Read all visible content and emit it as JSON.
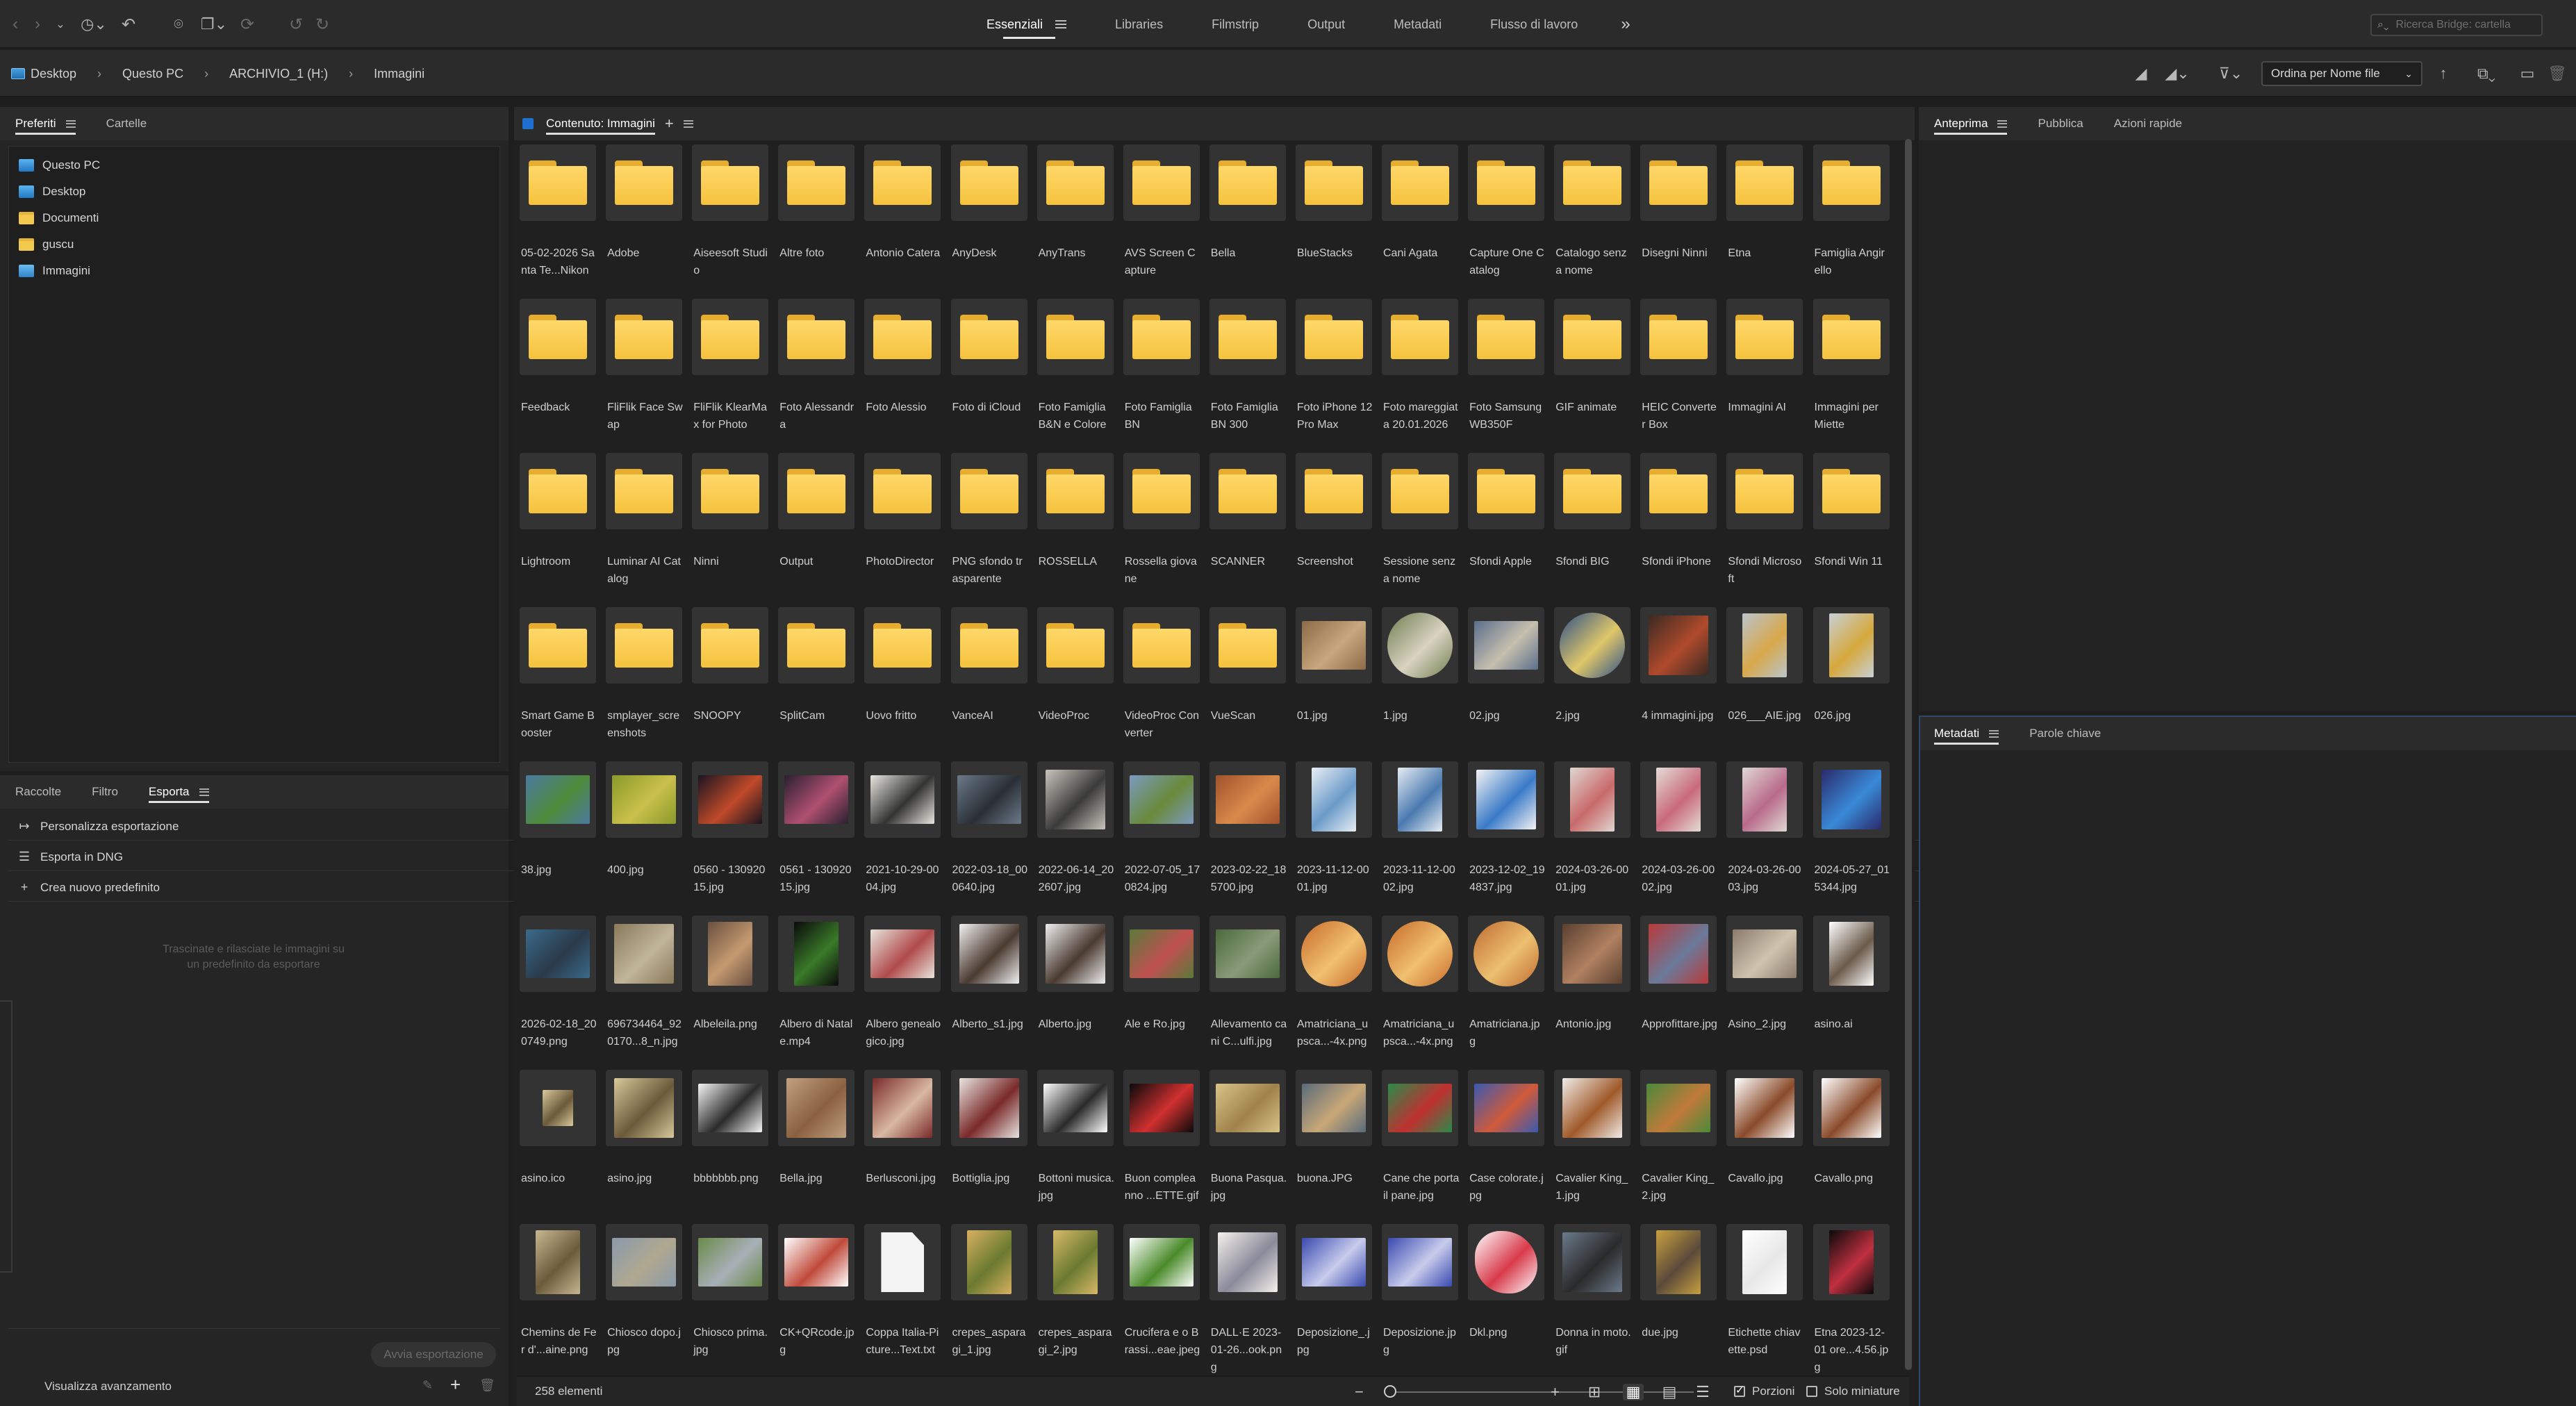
{
  "toolbar": {
    "icons": [
      "back-arrow-icon",
      "forward-arrow-icon",
      "chevron-down-icon",
      "recent-icon",
      "boomerang-icon",
      "camera-icon",
      "copy-icon",
      "refresh-icon",
      "undo-icon",
      "redo-icon"
    ],
    "workspaces": [
      {
        "label": "Essenziali",
        "active": true
      },
      {
        "label": "Libraries",
        "active": false
      },
      {
        "label": "Filmstrip",
        "active": false
      },
      {
        "label": "Output",
        "active": false
      },
      {
        "label": "Metadati",
        "active": false
      },
      {
        "label": "Flusso di lavoro",
        "active": false
      }
    ],
    "overflow_label": "»",
    "search_placeholder": "Ricerca Bridge: cartella"
  },
  "pathbar": {
    "crumbs": [
      "Desktop",
      "Questo PC",
      "ARCHIVIO_1 (H:)",
      "Immagini"
    ],
    "separator": "›",
    "sort_label": "Ordina per Nome file"
  },
  "left_top": {
    "tabs": [
      {
        "label": "Preferiti",
        "active": true
      },
      {
        "label": "Cartelle",
        "active": false
      }
    ],
    "favorites": [
      {
        "label": "Questo PC",
        "icon": "pc"
      },
      {
        "label": "Desktop",
        "icon": "pc"
      },
      {
        "label": "Documenti",
        "icon": "folder"
      },
      {
        "label": "guscu",
        "icon": "folder"
      },
      {
        "label": "Immagini",
        "icon": "img"
      }
    ]
  },
  "left_bottom": {
    "tabs": [
      {
        "label": "Raccolte",
        "active": false
      },
      {
        "label": "Filtro",
        "active": false
      },
      {
        "label": "Esporta",
        "active": true
      }
    ],
    "rows": [
      {
        "label": "Personalizza esportazione",
        "icon": "↦"
      },
      {
        "label": "Esporta in DNG",
        "icon": "☰"
      },
      {
        "label": "Crea nuovo predefinito",
        "icon": "+"
      }
    ],
    "drop_hint": "Trascinate e rilasciate le immagini su un predefinito da esportare",
    "export_button": "Avvia esportazione",
    "progress_label": "Visualizza avanzamento"
  },
  "content": {
    "title": "Contenuto: Immagini",
    "count": "258 elementi",
    "items": [
      {
        "name": "05-02-2026 Santa Te...Nikon",
        "kind": "folder"
      },
      {
        "name": "Adobe",
        "kind": "folder"
      },
      {
        "name": "Aiseesoft Studio",
        "kind": "folder"
      },
      {
        "name": "Altre foto",
        "kind": "folder"
      },
      {
        "name": "Antonio Catera",
        "kind": "folder"
      },
      {
        "name": "AnyDesk",
        "kind": "folder"
      },
      {
        "name": "AnyTrans",
        "kind": "folder"
      },
      {
        "name": "AVS Screen Capture",
        "kind": "folder"
      },
      {
        "name": "Bella",
        "kind": "folder"
      },
      {
        "name": "BlueStacks",
        "kind": "folder"
      },
      {
        "name": "Cani Agata",
        "kind": "folder"
      },
      {
        "name": "Capture One Catalog",
        "kind": "folder"
      },
      {
        "name": "Catalogo senza nome",
        "kind": "folder"
      },
      {
        "name": "Disegni Ninni",
        "kind": "folder"
      },
      {
        "name": "Etna",
        "kind": "folder"
      },
      {
        "name": "Famiglia Angirello",
        "kind": "folder"
      },
      {
        "name": "Feedback",
        "kind": "folder"
      },
      {
        "name": "FliFlik Face Swap",
        "kind": "folder"
      },
      {
        "name": "FliFlik KlearMax for Photo",
        "kind": "folder"
      },
      {
        "name": "Foto Alessandra",
        "kind": "folder"
      },
      {
        "name": "Foto Alessio",
        "kind": "folder"
      },
      {
        "name": "Foto di iCloud",
        "kind": "folder"
      },
      {
        "name": "Foto Famiglia B&N e Colore",
        "kind": "folder"
      },
      {
        "name": "Foto Famiglia BN",
        "kind": "folder"
      },
      {
        "name": "Foto Famiglia BN 300",
        "kind": "folder"
      },
      {
        "name": "Foto iPhone 12 Pro Max",
        "kind": "folder"
      },
      {
        "name": "Foto mareggiata 20.01.2026",
        "kind": "folder"
      },
      {
        "name": "Foto Samsung WB350F",
        "kind": "folder"
      },
      {
        "name": "GIF animate",
        "kind": "folder"
      },
      {
        "name": "HEIC Converter Box",
        "kind": "folder"
      },
      {
        "name": "Immagini AI",
        "kind": "folder"
      },
      {
        "name": "Immagini per Miette",
        "kind": "folder"
      },
      {
        "name": "Lightroom",
        "kind": "folder"
      },
      {
        "name": "Luminar AI Catalog",
        "kind": "folder"
      },
      {
        "name": "Ninni",
        "kind": "folder"
      },
      {
        "name": "Output",
        "kind": "folder"
      },
      {
        "name": "PhotoDirector",
        "kind": "folder"
      },
      {
        "name": "PNG sfondo trasparente",
        "kind": "folder"
      },
      {
        "name": "ROSSELLA",
        "kind": "folder"
      },
      {
        "name": "Rossella giovane",
        "kind": "folder"
      },
      {
        "name": "SCANNER",
        "kind": "folder"
      },
      {
        "name": "Screenshot",
        "kind": "folder"
      },
      {
        "name": "Sessione senza nome",
        "kind": "folder"
      },
      {
        "name": "Sfondi Apple",
        "kind": "folder"
      },
      {
        "name": "Sfondi BIG",
        "kind": "folder"
      },
      {
        "name": "Sfondi iPhone",
        "kind": "folder"
      },
      {
        "name": "Sfondi Microsoft",
        "kind": "folder"
      },
      {
        "name": "Sfondi Win 11",
        "kind": "folder"
      },
      {
        "name": "Smart Game Booster",
        "kind": "folder"
      },
      {
        "name": "smplayer_screenshots",
        "kind": "folder"
      },
      {
        "name": "SNOOPY",
        "kind": "folder"
      },
      {
        "name": "SplitCam",
        "kind": "folder"
      },
      {
        "name": "Uovo fritto",
        "kind": "folder"
      },
      {
        "name": "VanceAI",
        "kind": "folder"
      },
      {
        "name": "VideoProc",
        "kind": "folder"
      },
      {
        "name": "VideoProc Converter",
        "kind": "folder"
      },
      {
        "name": "VueScan",
        "kind": "folder"
      },
      {
        "name": "01.jpg",
        "kind": "image",
        "colors": [
          "#8a6b4a",
          "#c9a77d"
        ],
        "shape": "wide"
      },
      {
        "name": "1.jpg",
        "kind": "image",
        "colors": [
          "#6e7d4f",
          "#d9d3c0"
        ],
        "shape": "round"
      },
      {
        "name": "02.jpg",
        "kind": "image",
        "colors": [
          "#5a6f8c",
          "#c7bfae"
        ],
        "shape": "wide"
      },
      {
        "name": "2.jpg",
        "kind": "image",
        "colors": [
          "#2c4f8a",
          "#e0c768"
        ],
        "shape": "round"
      },
      {
        "name": "4 immagini.jpg",
        "kind": "image",
        "colors": [
          "#3a2a22",
          "#b04a2c"
        ],
        "shape": "square"
      },
      {
        "name": "026___AIE.jpg",
        "kind": "image",
        "colors": [
          "#b9c4cc",
          "#d8a84a"
        ],
        "shape": "tall"
      },
      {
        "name": "026.jpg",
        "kind": "image",
        "colors": [
          "#c8d0d6",
          "#d6a83c"
        ],
        "shape": "tall"
      },
      {
        "name": "38.jpg",
        "kind": "image",
        "colors": [
          "#4a7aa0",
          "#4f8a3a"
        ],
        "shape": "wide"
      },
      {
        "name": "400.jpg",
        "kind": "image",
        "colors": [
          "#8a9a2a",
          "#c9c04a"
        ],
        "shape": "wide"
      },
      {
        "name": "0560 - 13092015.jpg",
        "kind": "image",
        "colors": [
          "#1a1420",
          "#c04a2a"
        ],
        "shape": "wide"
      },
      {
        "name": "0561 - 13092015.jpg",
        "kind": "image",
        "colors": [
          "#2a2030",
          "#b05070"
        ],
        "shape": "wide"
      },
      {
        "name": "2021-10-29-0004.jpg",
        "kind": "image",
        "colors": [
          "#e8e6e0",
          "#333333"
        ],
        "shape": "wide"
      },
      {
        "name": "2022-03-18_000640.jpg",
        "kind": "image",
        "colors": [
          "#6a7a8a",
          "#2a2f35"
        ],
        "shape": "wide"
      },
      {
        "name": "2022-06-14_202607.jpg",
        "kind": "image",
        "colors": [
          "#c8c4bc",
          "#3a3a3a"
        ],
        "shape": "square"
      },
      {
        "name": "2022-07-05_170824.jpg",
        "kind": "image",
        "colors": [
          "#7a9ac0",
          "#6a8a3a"
        ],
        "shape": "wide"
      },
      {
        "name": "2023-02-22_185700.jpg",
        "kind": "image",
        "colors": [
          "#a0522d",
          "#d98a4a"
        ],
        "shape": "wide"
      },
      {
        "name": "2023-11-12-0001.jpg",
        "kind": "image",
        "colors": [
          "#e8eef4",
          "#6a9ac8"
        ],
        "shape": "tall"
      },
      {
        "name": "2023-11-12-0002.jpg",
        "kind": "image",
        "colors": [
          "#e6ecf2",
          "#4a7ab0"
        ],
        "shape": "tall"
      },
      {
        "name": "2023-12-02_194837.jpg",
        "kind": "image",
        "colors": [
          "#f4f4f4",
          "#3a7ac8"
        ],
        "shape": "square"
      },
      {
        "name": "2024-03-26-0001.jpg",
        "kind": "image",
        "colors": [
          "#e0d6d0",
          "#c86a6a"
        ],
        "shape": "tall"
      },
      {
        "name": "2024-03-26-0002.jpg",
        "kind": "image",
        "colors": [
          "#e4dcd6",
          "#c86a7a"
        ],
        "shape": "tall"
      },
      {
        "name": "2024-03-26-0003.jpg",
        "kind": "image",
        "colors": [
          "#e0d8d4",
          "#b86a8a"
        ],
        "shape": "tall"
      },
      {
        "name": "2024-05-27_015344.jpg",
        "kind": "image",
        "colors": [
          "#2a2a6a",
          "#3a8ad8"
        ],
        "shape": "square"
      },
      {
        "name": "2026-02-18_200749.png",
        "kind": "image",
        "colors": [
          "#3a6a8a",
          "#2a3a4a"
        ],
        "shape": "wide"
      },
      {
        "name": "696734464_920170...8_n.jpg",
        "kind": "image",
        "colors": [
          "#8a7a5a",
          "#c0b49a"
        ],
        "shape": "square"
      },
      {
        "name": "Albeleila.png",
        "kind": "image",
        "colors": [
          "#6a5040",
          "#c49a70"
        ],
        "shape": "tall"
      },
      {
        "name": "Albero di Natale.mp4",
        "kind": "image",
        "colors": [
          "#0a0a0a",
          "#3a7a2a"
        ],
        "shape": "tall"
      },
      {
        "name": "Albero genealogico.jpg",
        "kind": "image",
        "colors": [
          "#e8e4dc",
          "#b04a4a"
        ],
        "shape": "wide"
      },
      {
        "name": "Alberto_s1.jpg",
        "kind": "image",
        "colors": [
          "#f0f0f0",
          "#4a3a30"
        ],
        "shape": "square"
      },
      {
        "name": "Alberto.jpg",
        "kind": "image",
        "colors": [
          "#eeeeee",
          "#4a3a30"
        ],
        "shape": "square"
      },
      {
        "name": "Ale e Ro.jpg",
        "kind": "image",
        "colors": [
          "#5a7a3a",
          "#c05050"
        ],
        "shape": "wide"
      },
      {
        "name": "Allevamento cani C...ulfi.jpg",
        "kind": "image",
        "colors": [
          "#4a6a3a",
          "#8a9a7a"
        ],
        "shape": "wide"
      },
      {
        "name": "Amatriciana_upsca...-4x.png",
        "kind": "image",
        "colors": [
          "#c86a2a",
          "#f0c070"
        ],
        "shape": "round"
      },
      {
        "name": "Amatriciana_upsca...-4x.png",
        "kind": "image",
        "colors": [
          "#c86a2a",
          "#f0c070"
        ],
        "shape": "round"
      },
      {
        "name": "Amatriciana.jpg",
        "kind": "image",
        "colors": [
          "#c06a30",
          "#ecc070"
        ],
        "shape": "round"
      },
      {
        "name": "Antonio.jpg",
        "kind": "image",
        "colors": [
          "#5a4030",
          "#b08060"
        ],
        "shape": "square"
      },
      {
        "name": "Approfittare.jpg",
        "kind": "image",
        "colors": [
          "#b83a3a",
          "#6a7a9a"
        ],
        "shape": "square"
      },
      {
        "name": "Asino_2.jpg",
        "kind": "image",
        "colors": [
          "#8a7a6a",
          "#d0c4b0"
        ],
        "shape": "wide"
      },
      {
        "name": "asino.ai",
        "kind": "image",
        "colors": [
          "#ffffff",
          "#6a5a4a"
        ],
        "shape": "tall"
      },
      {
        "name": "asino.ico",
        "kind": "image",
        "colors": [
          "#d8c89a",
          "#6a5a3a"
        ],
        "shape": "small"
      },
      {
        "name": "asino.jpg",
        "kind": "image",
        "colors": [
          "#d8c89a",
          "#6a5a3a"
        ],
        "shape": "square"
      },
      {
        "name": "bbbbbbb.png",
        "kind": "image",
        "colors": [
          "#f4f4f4",
          "#2a2a2a"
        ],
        "shape": "wide"
      },
      {
        "name": "Bella.jpg",
        "kind": "image",
        "colors": [
          "#c0a080",
          "#8a6040"
        ],
        "shape": "square"
      },
      {
        "name": "Berlusconi.jpg",
        "kind": "image",
        "colors": [
          "#7a2a2a",
          "#d8b8a0"
        ],
        "shape": "square"
      },
      {
        "name": "Bottiglia.jpg",
        "kind": "image",
        "colors": [
          "#e8e4e0",
          "#7a2a2a"
        ],
        "shape": "square"
      },
      {
        "name": "Bottoni musica.jpg",
        "kind": "image",
        "colors": [
          "#ffffff",
          "#2a2a2a"
        ],
        "shape": "wide"
      },
      {
        "name": "Buon compleanno ...ETTE.gif",
        "kind": "image",
        "colors": [
          "#0a0a0a",
          "#d03030"
        ],
        "shape": "wide"
      },
      {
        "name": "Buona Pasqua.jpg",
        "kind": "image",
        "colors": [
          "#d8c48a",
          "#a0824a"
        ],
        "shape": "wide"
      },
      {
        "name": "buona.JPG",
        "kind": "image",
        "colors": [
          "#5a6a7a",
          "#c8a878"
        ],
        "shape": "wide"
      },
      {
        "name": "Cane che porta il pane.jpg",
        "kind": "image",
        "colors": [
          "#2a8a4a",
          "#c03030"
        ],
        "shape": "wide"
      },
      {
        "name": "Case colorate.jpg",
        "kind": "image",
        "colors": [
          "#3a5ab0",
          "#d05a3a"
        ],
        "shape": "wide"
      },
      {
        "name": "Cavalier King_1.jpg",
        "kind": "image",
        "colors": [
          "#f0ece8",
          "#a05a2a"
        ],
        "shape": "square"
      },
      {
        "name": "Cavalier King_2.jpg",
        "kind": "image",
        "colors": [
          "#4a8a3a",
          "#c07a3a"
        ],
        "shape": "wide"
      },
      {
        "name": "Cavallo.jpg",
        "kind": "image",
        "colors": [
          "#ffffff",
          "#8a4a2a"
        ],
        "shape": "square"
      },
      {
        "name": "Cavallo.png",
        "kind": "image",
        "colors": [
          "#ffffff",
          "#8a4a2a"
        ],
        "shape": "square"
      },
      {
        "name": "Chemins de Fer d'...aine.png",
        "kind": "image",
        "colors": [
          "#c8b890",
          "#6a5a3a"
        ],
        "shape": "tall"
      },
      {
        "name": "Chiosco dopo.jpg",
        "kind": "image",
        "colors": [
          "#8a9aac",
          "#b0a890"
        ],
        "shape": "wide"
      },
      {
        "name": "Chiosco prima.jpg",
        "kind": "image",
        "colors": [
          "#6a8a4a",
          "#a8b0b8"
        ],
        "shape": "wide"
      },
      {
        "name": "CK+QRcode.jpg",
        "kind": "image",
        "colors": [
          "#ffffff",
          "#c04a3a"
        ],
        "shape": "wide"
      },
      {
        "name": "Coppa Italia-Picture...Text.txt",
        "kind": "doc",
        "colors": [
          "#f4f4f4",
          "#d0d0d0"
        ],
        "shape": "doc"
      },
      {
        "name": "crepes_asparagi_1.jpg",
        "kind": "image",
        "colors": [
          "#d8b060",
          "#6a7a30"
        ],
        "shape": "tall"
      },
      {
        "name": "crepes_asparagi_2.jpg",
        "kind": "image",
        "colors": [
          "#d8b868",
          "#6a7a30"
        ],
        "shape": "tall"
      },
      {
        "name": "Crucifera e o Brassi...eae.jpeg",
        "kind": "image",
        "colors": [
          "#ffffff",
          "#4a8a2a"
        ],
        "shape": "wide"
      },
      {
        "name": "DALL·E 2023-01-26...ook.png",
        "kind": "image",
        "colors": [
          "#f4f0ec",
          "#8a8a9a"
        ],
        "shape": "square"
      },
      {
        "name": "Deposizione_.jpg",
        "kind": "image",
        "colors": [
          "#3a4ab0",
          "#c8ccec"
        ],
        "shape": "wide"
      },
      {
        "name": "Deposizione.jpg",
        "kind": "image",
        "colors": [
          "#3a4ab0",
          "#c8ccec"
        ],
        "shape": "wide"
      },
      {
        "name": "Dkl.png",
        "kind": "image",
        "colors": [
          "#ffffff",
          "#d83a4a"
        ],
        "shape": "flower"
      },
      {
        "name": "Donna in moto.gif",
        "kind": "image",
        "colors": [
          "#6a7a8a",
          "#2a2a2a"
        ],
        "shape": "square"
      },
      {
        "name": "due.jpg",
        "kind": "image",
        "colors": [
          "#c8a040",
          "#5a4a3a"
        ],
        "shape": "tall"
      },
      {
        "name": "Etichette chiavette.psd",
        "kind": "image",
        "colors": [
          "#ffffff",
          "#e8e8e8"
        ],
        "shape": "tall"
      },
      {
        "name": "Etna 2023-12-01 ore...4.56.jpg",
        "kind": "image",
        "colors": [
          "#0a0a0a",
          "#c03040"
        ],
        "shape": "tall"
      }
    ],
    "zoom_icons": [
      "minus-icon",
      "plus-icon"
    ],
    "view_modes": [
      "grid-view-icon",
      "thumbnails-view-icon",
      "details-view-icon",
      "list-view-icon"
    ],
    "checkbox_portions": "Porzioni",
    "checkbox_thumbs_only": "Solo miniature"
  },
  "right_top": {
    "tabs": [
      {
        "label": "Anteprima",
        "active": true
      },
      {
        "label": "Pubblica",
        "active": false
      },
      {
        "label": "Azioni rapide",
        "active": false
      }
    ]
  },
  "right_bottom": {
    "tabs": [
      {
        "label": "Metadati",
        "active": true
      },
      {
        "label": "Parole chiave",
        "active": false
      }
    ]
  }
}
